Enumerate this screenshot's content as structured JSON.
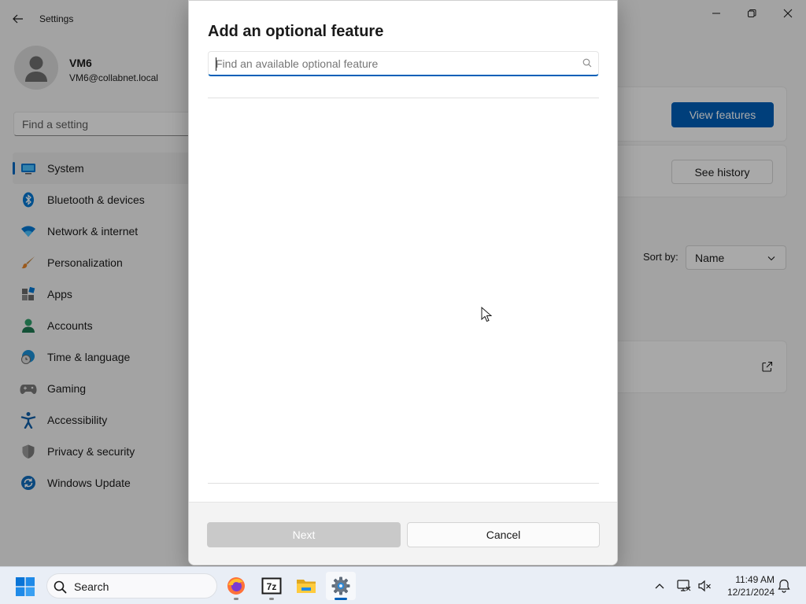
{
  "window": {
    "title": "Settings"
  },
  "profile": {
    "name": "VM6",
    "email": "VM6@collabnet.local"
  },
  "search": {
    "placeholder": "Find a setting"
  },
  "sidebar": {
    "items": [
      {
        "label": "System",
        "icon": "system-monitor-icon",
        "active": true
      },
      {
        "label": "Bluetooth & devices",
        "icon": "bluetooth-icon"
      },
      {
        "label": "Network & internet",
        "icon": "wifi-icon"
      },
      {
        "label": "Personalization",
        "icon": "paintbrush-icon"
      },
      {
        "label": "Apps",
        "icon": "apps-icon"
      },
      {
        "label": "Accounts",
        "icon": "person-icon"
      },
      {
        "label": "Time & language",
        "icon": "clock-globe-icon"
      },
      {
        "label": "Gaming",
        "icon": "gamepad-icon"
      },
      {
        "label": "Accessibility",
        "icon": "accessibility-icon"
      },
      {
        "label": "Privacy & security",
        "icon": "shield-icon"
      },
      {
        "label": "Windows Update",
        "icon": "update-icon"
      }
    ]
  },
  "main": {
    "view_features_label": "View features",
    "see_history_label": "See history",
    "sort_label": "Sort by:",
    "sort_value": "Name"
  },
  "dialog": {
    "title": "Add an optional feature",
    "search_placeholder": "Find an available optional feature",
    "next_label": "Next",
    "cancel_label": "Cancel"
  },
  "taskbar": {
    "search_label": "Search",
    "apps": [
      "firefox-icon",
      "7zip-icon",
      "file-explorer-icon",
      "settings-icon"
    ],
    "time": "11:49 AM",
    "date": "12/21/2024"
  },
  "colors": {
    "accent": "#005fb8",
    "window_bg": "#f3f3f3",
    "taskbar_bg": "#e9eef6"
  }
}
